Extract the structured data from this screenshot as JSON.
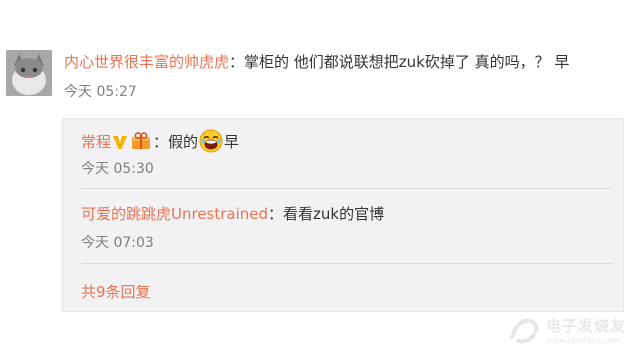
{
  "main_comment": {
    "username": "内心世界很丰富的帅虎虎",
    "text": "：掌柜的 他们都说联想把zuk砍掉了 真的吗，？ 早",
    "time": "今天 05:27"
  },
  "replies": [
    {
      "username": "常程",
      "text_before_emoji": "：假的",
      "text_after_emoji": "早",
      "time": "今天 05:30",
      "badges": [
        "verified-v-icon",
        "vip-gift-icon"
      ],
      "emoji": "laughing-face-emoji"
    },
    {
      "username": "可爱的跳跳虎Unrestrained",
      "text": "：看看zuk的官博",
      "time": "今天 07:03"
    }
  ],
  "more_replies_label": "共9条回复",
  "watermark": {
    "text": "电子发烧友",
    "subtext": "www.elecfans.com"
  },
  "colors": {
    "username": "#eb7350",
    "time": "#808080",
    "reply_bg": "#f2f2f5"
  }
}
